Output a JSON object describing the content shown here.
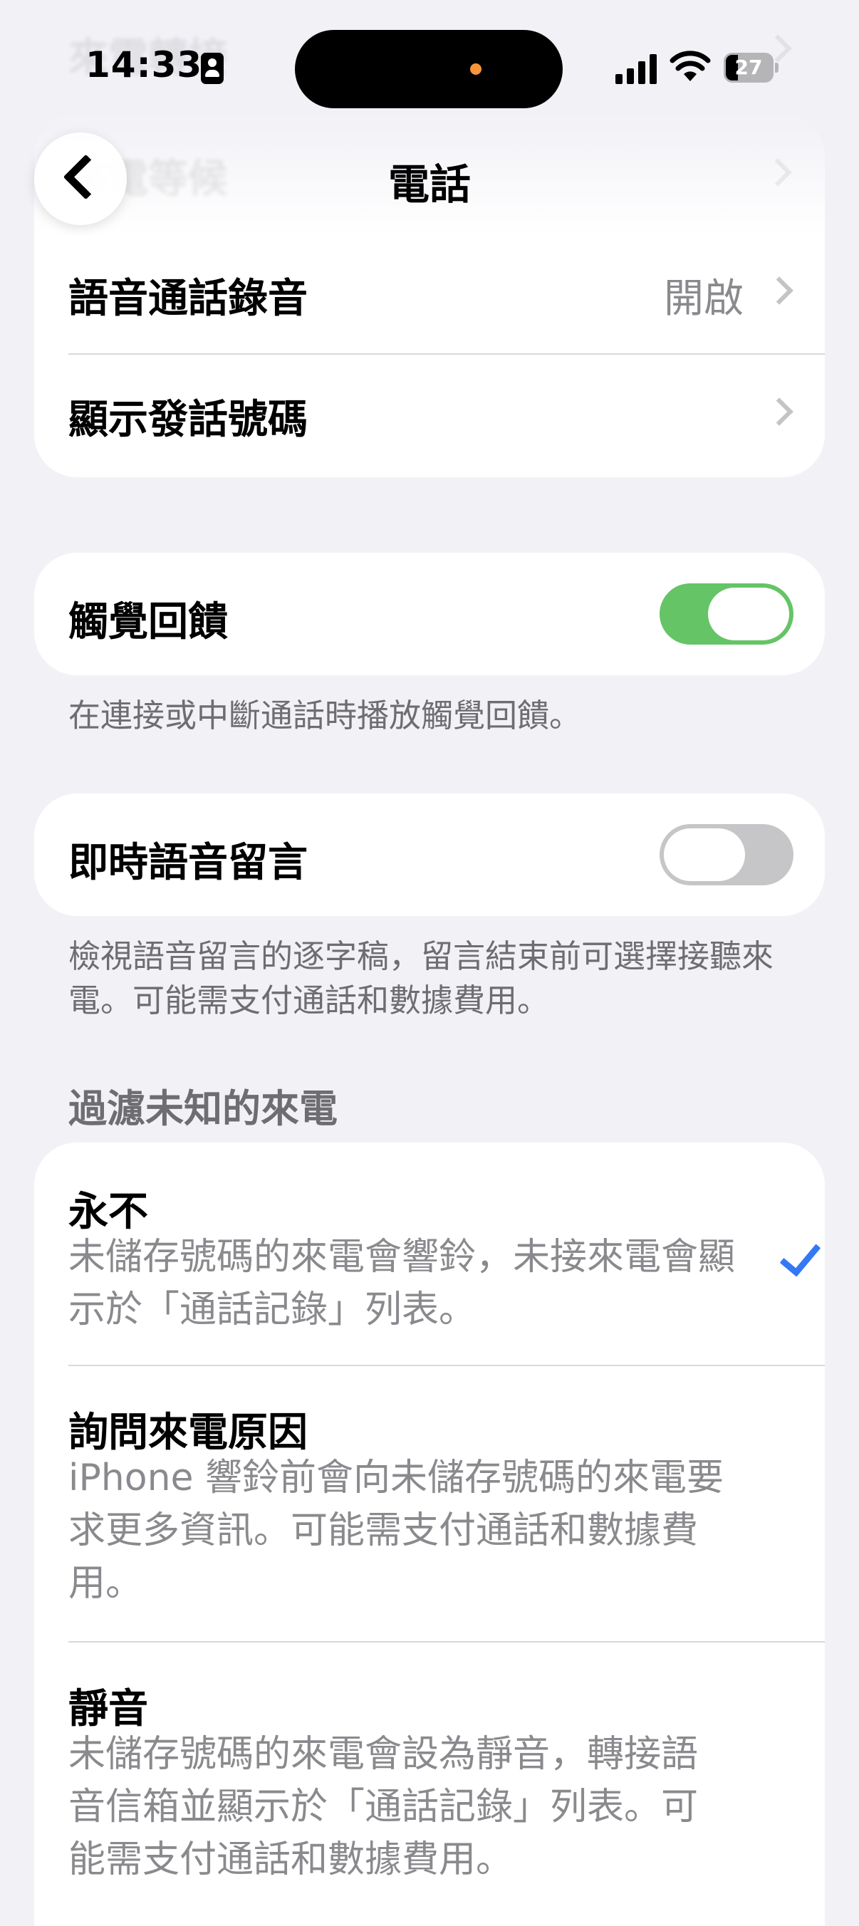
{
  "status_bar": {
    "time": "14:33",
    "battery": "27"
  },
  "nav": {
    "title": "電話",
    "back_icon": "chevron-left-icon",
    "behind_rows": [
      "來電轉接",
      "來電等候"
    ]
  },
  "call_settings": {
    "items": [
      {
        "label": "語音通話錄音",
        "value": "開啟",
        "icon": "chevron-right-icon"
      },
      {
        "label": "顯示發話號碼",
        "value": "",
        "icon": "chevron-right-icon"
      }
    ]
  },
  "haptics": {
    "label": "觸覺回饋",
    "enabled": true,
    "footnote": "在連接或中斷通話時播放觸覺回饋。"
  },
  "live_voicemail": {
    "label": "即時語音留言",
    "enabled": false,
    "footnote": "檢視語音留言的逐字稿，留言結束前可選擇接聽來電。可能需支付通話和數據費用。"
  },
  "screen_unknown": {
    "header": "過濾未知的來電",
    "options": [
      {
        "title": "永不",
        "desc": "未儲存號碼的來電會響鈴，未接來電會顯示於「通話記錄」列表。",
        "selected": true
      },
      {
        "title": "詢問來電原因",
        "desc": "iPhone 響鈴前會向未儲存號碼的來電要求更多資訊。可能需支付通話和數據費用。",
        "selected": false
      },
      {
        "title": "靜音",
        "desc": "未儲存號碼的來電會設為靜音，轉接語音信箱並顯示於「通話記錄」列表。可能需支付通話和數據費用。",
        "selected": false
      }
    ]
  },
  "colors": {
    "background": "#F2F1F6",
    "toggle_on": "#65C466",
    "toggle_off": "#C6C6C8",
    "checkmark": "#3478F6",
    "secondary_text": "#8A8A8E"
  }
}
